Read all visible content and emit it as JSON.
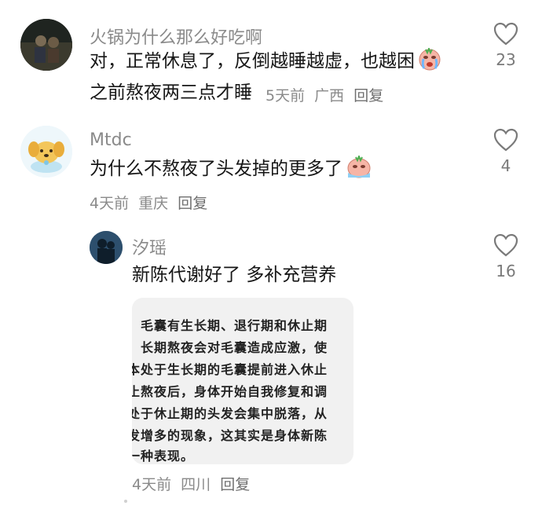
{
  "comments": [
    {
      "username": "火锅为什么那么好吃啊",
      "text_line1": "对，正常休息了，反倒越睡越虚，也越困",
      "text_line2": "之前熬夜两三点才睡",
      "time": "5天前",
      "location": "广西",
      "reply_label": "回复",
      "likes": "23",
      "emoji_icon": "crying-face-icon"
    },
    {
      "username": "Mtdc",
      "text_line1": "为什么不熬夜了头发掉的更多了",
      "time": "4天前",
      "location": "重庆",
      "reply_label": "回复",
      "likes": "4",
      "emoji_icon": "crying-face-icon"
    },
    {
      "username": "汐瑶",
      "text_line1": "新陈代谢好了 多补充营养",
      "time": "4天前",
      "location": "四川",
      "reply_label": "回复",
      "likes": "16",
      "image_lines": [
        "：毛囊有生长期、退行期和休止期",
        "。长期熬夜会对毛囊造成应激，使",
        "本处于生长期的毛囊提前进入休止",
        "止熬夜后，身体开始自我修复和调",
        "处于休止期的头发会集中脱落，从",
        "发增多的现象，这其实是身体新陈",
        "一种表现。"
      ]
    }
  ]
}
